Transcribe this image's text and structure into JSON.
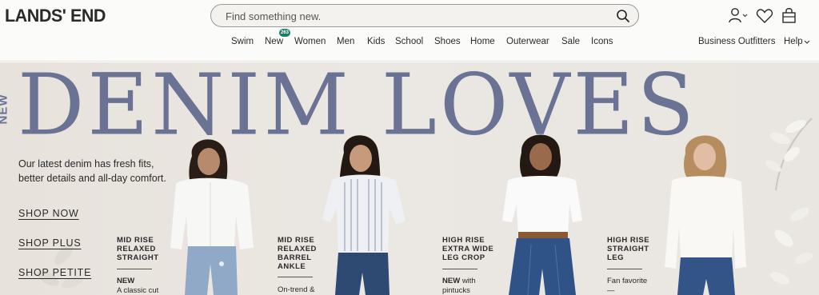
{
  "header": {
    "logo": "LANDS' END",
    "search_placeholder": "Find something new.",
    "icons": [
      "account-icon",
      "heart-icon",
      "bag-icon"
    ]
  },
  "nav": {
    "items": [
      "Swim",
      "New",
      "Women",
      "Men",
      "Kids",
      "School",
      "Shoes",
      "Home",
      "Outerwear",
      "Sale",
      "Icons"
    ],
    "new_badge": "263",
    "right_items": [
      "Business Outfitters",
      "Help"
    ]
  },
  "hero": {
    "new_tag": "NEW",
    "headline": "DENIM LOVES",
    "intro": "Our latest denim has fresh fits, better details and all-day comfort.",
    "links": [
      "SHOP NOW",
      "SHOP PLUS",
      "SHOP PETITE"
    ],
    "fits": [
      {
        "title": "MID RISE RELAXED STRAIGHT",
        "desc_bold": "NEW",
        "desc": "A classic cut"
      },
      {
        "title": "MID RISE RELAXED BARREL ANKLE",
        "desc_bold": "",
        "desc": "On-trend &"
      },
      {
        "title": "HIGH RISE EXTRA WIDE LEG CROP",
        "desc_bold": "NEW",
        "desc": "with pintucks"
      },
      {
        "title": "HIGH RISE STRAIGHT LEG",
        "desc_bold": "",
        "desc": "Fan favorite—"
      }
    ]
  },
  "colors": {
    "headline": "#6b7394",
    "badge": "#1f7a6a",
    "hero_bg": "#e9e5e0"
  }
}
